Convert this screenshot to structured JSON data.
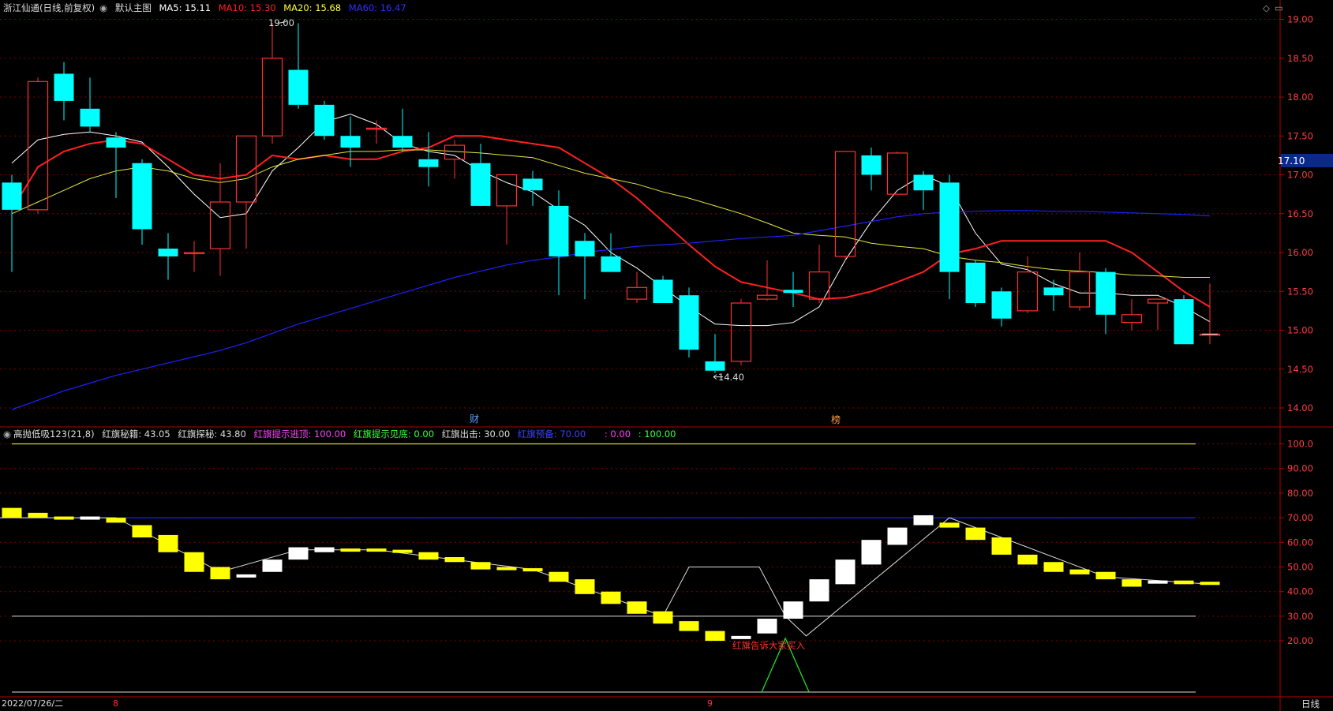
{
  "main_legend": {
    "stock": "浙江仙通(日线,前复权)",
    "main_chart": "默认主图",
    "ma5": {
      "label": "MA5: 15.11",
      "color": "#ffffff"
    },
    "ma10": {
      "label": "MA10: 15.30",
      "color": "#ff2020"
    },
    "ma20": {
      "label": "MA20: 15.68",
      "color": "#ffff40"
    },
    "ma60": {
      "label": "MA60: 16.47",
      "color": "#2020ff"
    }
  },
  "sub_legend": {
    "indicator": "高抛低吸123(21,8)",
    "items": [
      {
        "label": "红旗秘籍: 43.05",
        "color": "#dddddd"
      },
      {
        "label": "红旗探秘: 43.80",
        "color": "#dddddd"
      },
      {
        "label": "红旗提示逃顶: 100.00",
        "color": "#ff40ff"
      },
      {
        "label": "红旗提示见底: 0.00",
        "color": "#40ff40"
      },
      {
        "label": "红旗出击: 30.00",
        "color": "#dddddd"
      },
      {
        "label": "红旗预备: 70.00",
        "color": "#4040ff"
      },
      {
        "label": ": 0.00",
        "color": "#ff40ff"
      },
      {
        "label": ": 100.00",
        "color": "#40ff40"
      }
    ]
  },
  "annotations": {
    "high_label": "19.00",
    "low_label": "14.40",
    "current_price": "17.10",
    "finance_marker": "财",
    "rank_marker": "榜",
    "buy_signal": "红旗告诉大家买入"
  },
  "bottom_axis": {
    "date": "2022/07/26/二",
    "month1": "8",
    "month2": "9",
    "period": "日线"
  },
  "colors": {
    "up": "#ff3030",
    "down": "#00ffff",
    "grid": "#800000",
    "axis": "#b00000"
  },
  "chart_data": [
    {
      "type": "candlestick",
      "y_ticks": [
        "19.00",
        "18.50",
        "18.00",
        "17.50",
        "17.00",
        "16.50",
        "16.00",
        "15.50",
        "15.00",
        "14.50",
        "14.00"
      ],
      "ylim": [
        13.85,
        19.35
      ],
      "candles": [
        {
          "o": 16.9,
          "h": 17.0,
          "l": 15.75,
          "c": 16.55
        },
        {
          "o": 16.55,
          "h": 18.25,
          "l": 16.5,
          "c": 18.2
        },
        {
          "o": 18.3,
          "h": 18.45,
          "l": 17.7,
          "c": 17.95
        },
        {
          "o": 17.85,
          "h": 18.25,
          "l": 17.55,
          "c": 17.62
        },
        {
          "o": 17.48,
          "h": 17.55,
          "l": 16.7,
          "c": 17.35
        },
        {
          "o": 17.15,
          "h": 17.2,
          "l": 16.1,
          "c": 16.3
        },
        {
          "o": 16.05,
          "h": 16.25,
          "l": 15.65,
          "c": 15.95
        },
        {
          "o": 16.0,
          "h": 16.15,
          "l": 15.75,
          "c": 16.0
        },
        {
          "o": 16.05,
          "h": 17.15,
          "l": 15.7,
          "c": 16.65
        },
        {
          "o": 16.65,
          "h": 17.5,
          "l": 16.05,
          "c": 17.5
        },
        {
          "o": 17.5,
          "h": 18.95,
          "l": 17.4,
          "c": 18.5
        },
        {
          "o": 18.35,
          "h": 18.95,
          "l": 17.85,
          "c": 17.9
        },
        {
          "o": 17.9,
          "h": 17.95,
          "l": 17.45,
          "c": 17.5
        },
        {
          "o": 17.5,
          "h": 17.75,
          "l": 17.1,
          "c": 17.35
        },
        {
          "o": 17.6,
          "h": 17.7,
          "l": 17.4,
          "c": 17.6
        },
        {
          "o": 17.5,
          "h": 17.85,
          "l": 17.3,
          "c": 17.35
        },
        {
          "o": 17.2,
          "h": 17.55,
          "l": 16.85,
          "c": 17.1
        },
        {
          "o": 17.2,
          "h": 17.45,
          "l": 16.95,
          "c": 17.38
        },
        {
          "o": 17.15,
          "h": 17.4,
          "l": 16.6,
          "c": 16.6
        },
        {
          "o": 16.6,
          "h": 17.0,
          "l": 16.1,
          "c": 17.0
        },
        {
          "o": 16.95,
          "h": 17.05,
          "l": 16.6,
          "c": 16.8
        },
        {
          "o": 16.6,
          "h": 16.8,
          "l": 15.45,
          "c": 15.95
        },
        {
          "o": 16.15,
          "h": 16.25,
          "l": 15.4,
          "c": 15.95
        },
        {
          "o": 15.95,
          "h": 16.25,
          "l": 15.75,
          "c": 15.75
        },
        {
          "o": 15.4,
          "h": 15.75,
          "l": 15.35,
          "c": 15.55
        },
        {
          "o": 15.65,
          "h": 15.7,
          "l": 15.35,
          "c": 15.35
        },
        {
          "o": 15.45,
          "h": 15.55,
          "l": 14.65,
          "c": 14.75
        },
        {
          "o": 14.6,
          "h": 14.95,
          "l": 14.45,
          "c": 14.48
        },
        {
          "o": 14.6,
          "h": 15.4,
          "l": 14.55,
          "c": 15.35
        },
        {
          "o": 15.4,
          "h": 15.9,
          "l": 15.38,
          "c": 15.45
        },
        {
          "o": 15.52,
          "h": 15.75,
          "l": 15.3,
          "c": 15.48
        },
        {
          "o": 15.4,
          "h": 16.1,
          "l": 15.35,
          "c": 15.75
        },
        {
          "o": 15.95,
          "h": 17.3,
          "l": 15.9,
          "c": 17.3
        },
        {
          "o": 17.25,
          "h": 17.35,
          "l": 16.8,
          "c": 17.0
        },
        {
          "o": 16.75,
          "h": 17.3,
          "l": 16.75,
          "c": 17.28
        },
        {
          "o": 17.0,
          "h": 17.05,
          "l": 16.55,
          "c": 16.8
        },
        {
          "o": 16.9,
          "h": 17.0,
          "l": 15.4,
          "c": 15.75
        },
        {
          "o": 15.87,
          "h": 15.9,
          "l": 15.3,
          "c": 15.35
        },
        {
          "o": 15.5,
          "h": 15.55,
          "l": 15.05,
          "c": 15.15
        },
        {
          "o": 15.25,
          "h": 15.95,
          "l": 15.22,
          "c": 15.75
        },
        {
          "o": 15.55,
          "h": 15.65,
          "l": 15.25,
          "c": 15.45
        },
        {
          "o": 15.3,
          "h": 16.0,
          "l": 15.25,
          "c": 15.75
        },
        {
          "o": 15.75,
          "h": 15.8,
          "l": 14.95,
          "c": 15.2
        },
        {
          "o": 15.1,
          "h": 15.4,
          "l": 15.0,
          "c": 15.2
        },
        {
          "o": 15.35,
          "h": 15.4,
          "l": 15.0,
          "c": 15.4
        },
        {
          "o": 15.4,
          "h": 15.45,
          "l": 14.82,
          "c": 14.82
        },
        {
          "o": 14.95,
          "h": 15.6,
          "l": 14.82,
          "c": 14.95
        }
      ],
      "series": [
        {
          "name": "MA5",
          "values": [
            17.15,
            17.45,
            17.52,
            17.55,
            17.5,
            17.42,
            17.1,
            16.75,
            16.45,
            16.5,
            17.05,
            17.35,
            17.68,
            17.78,
            17.65,
            17.4,
            17.3,
            17.25,
            17.05,
            16.9,
            16.78,
            16.55,
            16.35,
            16.0,
            15.8,
            15.55,
            15.3,
            15.08,
            15.06,
            15.06,
            15.1,
            15.3,
            15.9,
            16.4,
            16.8,
            17.0,
            16.85,
            16.25,
            15.85,
            15.78,
            15.6,
            15.48,
            15.48,
            15.45,
            15.45,
            15.3,
            15.11
          ]
        },
        {
          "name": "MA10",
          "values": [
            16.55,
            17.1,
            17.3,
            17.4,
            17.45,
            17.4,
            17.2,
            17.0,
            16.95,
            17.0,
            17.25,
            17.2,
            17.25,
            17.2,
            17.2,
            17.3,
            17.35,
            17.5,
            17.5,
            17.45,
            17.4,
            17.35,
            17.15,
            16.95,
            16.7,
            16.4,
            16.1,
            15.82,
            15.62,
            15.55,
            15.48,
            15.4,
            15.42,
            15.5,
            15.62,
            15.75,
            15.98,
            16.05,
            16.15,
            16.15,
            16.15,
            16.15,
            16.15,
            16.0,
            15.75,
            15.5,
            15.3
          ]
        },
        {
          "name": "MA20",
          "values": [
            16.5,
            16.65,
            16.8,
            16.95,
            17.05,
            17.1,
            17.05,
            16.95,
            16.9,
            16.95,
            17.1,
            17.2,
            17.25,
            17.3,
            17.3,
            17.32,
            17.32,
            17.3,
            17.28,
            17.25,
            17.22,
            17.12,
            17.02,
            16.95,
            16.88,
            16.78,
            16.7,
            16.6,
            16.5,
            16.38,
            16.25,
            16.22,
            16.2,
            16.12,
            16.08,
            16.05,
            15.95,
            15.9,
            15.87,
            15.82,
            15.78,
            15.76,
            15.74,
            15.71,
            15.7,
            15.68,
            15.68
          ]
        },
        {
          "name": "MA60",
          "values": [
            13.98,
            14.1,
            14.22,
            14.32,
            14.42,
            14.5,
            14.58,
            14.66,
            14.74,
            14.84,
            14.96,
            15.08,
            15.18,
            15.28,
            15.38,
            15.48,
            15.58,
            15.68,
            15.76,
            15.84,
            15.9,
            15.94,
            16.0,
            16.04,
            16.08,
            16.1,
            16.12,
            16.15,
            16.18,
            16.2,
            16.22,
            16.28,
            16.34,
            16.4,
            16.46,
            16.5,
            16.52,
            16.53,
            16.54,
            16.54,
            16.53,
            16.53,
            16.52,
            16.51,
            16.5,
            16.49,
            16.47
          ]
        }
      ]
    },
    {
      "type": "bar",
      "y_ticks": [
        "100.0",
        "90.00",
        "80.00",
        "70.00",
        "60.00",
        "50.00",
        "40.00",
        "30.00",
        "20.00"
      ],
      "ylim": [
        7,
        105
      ],
      "levels": {
        "top": 100,
        "upper": 70,
        "lower": 30,
        "bottom": 0
      },
      "blocks": [
        {
          "o": 74,
          "c": 70,
          "k": "y"
        },
        {
          "o": 72,
          "c": 70,
          "k": "y"
        },
        {
          "o": 70.5,
          "c": 70,
          "k": "y"
        },
        {
          "o": 70.5,
          "c": 70,
          "k": "w"
        },
        {
          "o": 70,
          "c": 68,
          "k": "y"
        },
        {
          "o": 67,
          "c": 62,
          "k": "y"
        },
        {
          "o": 63,
          "c": 56,
          "k": "y"
        },
        {
          "o": 56,
          "c": 48,
          "k": "y"
        },
        {
          "o": 50,
          "c": 45,
          "k": "y"
        },
        {
          "o": 47,
          "c": 47,
          "k": "w"
        },
        {
          "o": 48,
          "c": 53,
          "k": "w"
        },
        {
          "o": 53,
          "c": 58,
          "k": "w"
        },
        {
          "o": 56,
          "c": 58,
          "k": "w"
        },
        {
          "o": 57.5,
          "c": 57,
          "k": "y"
        },
        {
          "o": 57.5,
          "c": 57,
          "k": "y"
        },
        {
          "o": 57,
          "c": 56,
          "k": "y"
        },
        {
          "o": 56,
          "c": 53,
          "k": "y"
        },
        {
          "o": 54,
          "c": 52,
          "k": "y"
        },
        {
          "o": 52,
          "c": 49,
          "k": "y"
        },
        {
          "o": 50,
          "c": 49,
          "k": "y"
        },
        {
          "o": 49.5,
          "c": 49,
          "k": "y"
        },
        {
          "o": 48,
          "c": 44,
          "k": "y"
        },
        {
          "o": 45,
          "c": 39,
          "k": "y"
        },
        {
          "o": 40,
          "c": 35,
          "k": "y"
        },
        {
          "o": 36,
          "c": 31,
          "k": "y"
        },
        {
          "o": 32,
          "c": 27,
          "k": "y"
        },
        {
          "o": 28,
          "c": 24,
          "k": "y"
        },
        {
          "o": 24,
          "c": 20,
          "k": "y"
        },
        {
          "o": 21,
          "c": 22,
          "k": "w"
        },
        {
          "o": 23,
          "c": 29,
          "k": "w"
        },
        {
          "o": 29,
          "c": 36,
          "k": "w"
        },
        {
          "o": 36,
          "c": 45,
          "k": "w"
        },
        {
          "o": 43,
          "c": 53,
          "k": "w"
        },
        {
          "o": 51,
          "c": 61,
          "k": "w"
        },
        {
          "o": 59,
          "c": 66,
          "k": "w"
        },
        {
          "o": 67,
          "c": 71,
          "k": "w"
        },
        {
          "o": 68,
          "c": 66,
          "k": "y"
        },
        {
          "o": 66,
          "c": 61,
          "k": "y"
        },
        {
          "o": 62,
          "c": 55,
          "k": "y"
        },
        {
          "o": 55,
          "c": 51,
          "k": "y"
        },
        {
          "o": 52,
          "c": 48,
          "k": "y"
        },
        {
          "o": 49,
          "c": 47,
          "k": "y"
        },
        {
          "o": 48,
          "c": 45,
          "k": "y"
        },
        {
          "o": 45,
          "c": 42,
          "k": "y"
        },
        {
          "o": 44.5,
          "c": 44,
          "k": "w"
        },
        {
          "o": 44.5,
          "c": 43,
          "k": "y"
        },
        {
          "o": 44,
          "c": 43,
          "k": "y"
        }
      ],
      "signal_line": [
        {
          "i": -1,
          "v": 70
        },
        {
          "i": 4,
          "v": 70
        },
        {
          "i": 8,
          "v": 48
        },
        {
          "i": 11,
          "v": 57
        },
        {
          "i": 14,
          "v": 57
        },
        {
          "i": 20,
          "v": 49
        },
        {
          "i": 25,
          "v": 30
        },
        {
          "i": 26,
          "v": 50
        },
        {
          "i": 28.7,
          "v": 50
        },
        {
          "i": 29.7,
          "v": 30
        },
        {
          "i": 30.5,
          "v": 22
        },
        {
          "i": 36,
          "v": 70
        },
        {
          "i": 42,
          "v": 46
        },
        {
          "i": 46,
          "v": 43
        }
      ],
      "green_spike": {
        "i": 29.7,
        "v": 22
      }
    }
  ]
}
